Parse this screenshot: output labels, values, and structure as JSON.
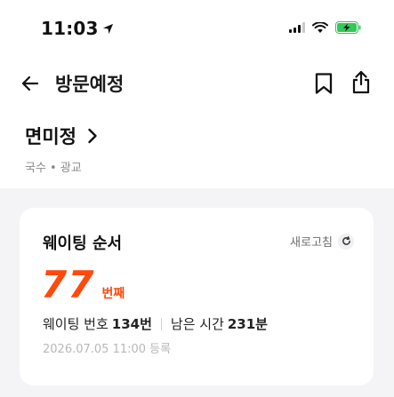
{
  "status_bar": {
    "time": "11:03"
  },
  "nav": {
    "title": "방문예정"
  },
  "store": {
    "name": "면미정",
    "category": "국수 • 광교"
  },
  "waiting": {
    "title": "웨이팅 순서",
    "refresh_label": "새로고침",
    "order_number": "77",
    "order_unit": "번째",
    "number_label": "웨이팅 번호",
    "number_value": "134번",
    "remaining_label": "남은 시간",
    "remaining_value": "231분",
    "registered_at": "2026.07.05 11:00 등록"
  },
  "colors": {
    "accent": "#ff4a0b",
    "battery": "#34c759",
    "band": "#f4f4f6"
  },
  "icons": {
    "back": "arrow-left-icon",
    "bookmark": "bookmark-icon",
    "share": "share-icon",
    "chevron": "chevron-right-icon",
    "refresh": "refresh-icon"
  }
}
